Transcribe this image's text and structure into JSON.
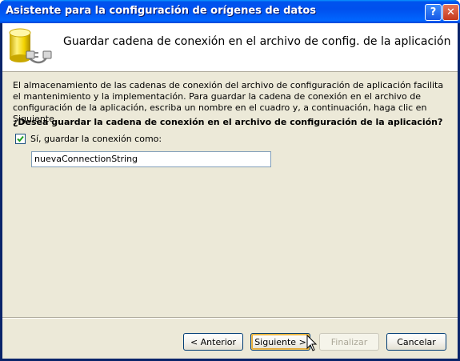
{
  "window": {
    "title": "Asistente para la configuración de orígenes de datos",
    "help_button": "?",
    "close_button": "✕"
  },
  "header": {
    "title": "Guardar cadena de conexión en el archivo de config. de la aplicación",
    "icon": "database-plug-icon"
  },
  "body": {
    "description": "El almacenamiento de las cadenas de conexión del archivo de configuración de aplicación facilita el mantenimiento y la implementación. Para guardar la cadena de conexión en el archivo de configuración de la aplicación, escriba un nombre en el cuadro y, a continuación, haga clic en Siguiente.",
    "question": "¿Desea guardar la cadena de conexión en el archivo de configuración de la aplicación?",
    "checkbox_label": "Sí, guardar la conexión como:",
    "checkbox_checked": true,
    "connection_name_value": "nuevaConnectionString"
  },
  "buttons": {
    "back": "< Anterior",
    "next": "Siguiente >",
    "finish": "Finalizar",
    "cancel": "Cancelar"
  },
  "colors": {
    "titlebar": "#0053ee",
    "dialog_bg": "#ece9d8"
  }
}
